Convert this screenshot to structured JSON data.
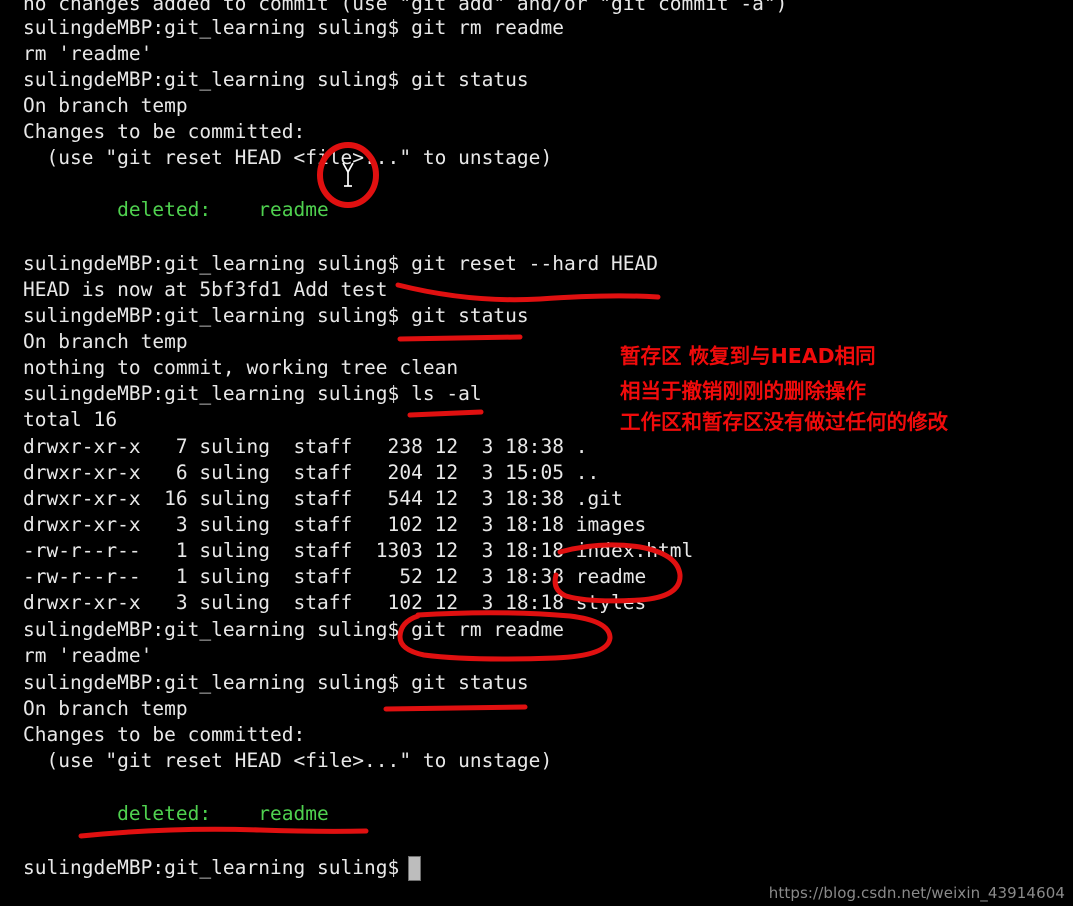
{
  "terminal": {
    "background_color": "#000000",
    "text_color": "#e8e8e8",
    "green_color": "#4fd14f",
    "annotation_color": "#f00b0b",
    "prompt": "sulingdeMBP:git_learning suling$",
    "lines": [
      {
        "text": "no changes added to commit (use \"git add\" and/or \"git commit -a\")",
        "color": "white"
      },
      {
        "text": "sulingdeMBP:git_learning suling$ git rm readme",
        "color": "white"
      },
      {
        "text": "rm 'readme'",
        "color": "white"
      },
      {
        "text": "sulingdeMBP:git_learning suling$ git status",
        "color": "white"
      },
      {
        "text": "On branch temp",
        "color": "white"
      },
      {
        "text": "Changes to be committed:",
        "color": "white"
      },
      {
        "text": "  (use \"git reset HEAD <file>...\" to unstage)",
        "color": "white"
      },
      {
        "text": "",
        "color": "white"
      },
      {
        "text": "        deleted:    readme",
        "color": "green"
      },
      {
        "text": "",
        "color": "white"
      },
      {
        "text": "sulingdeMBP:git_learning suling$ git reset --hard HEAD",
        "color": "white"
      },
      {
        "text": "HEAD is now at 5bf3fd1 Add test",
        "color": "white"
      },
      {
        "text": "sulingdeMBP:git_learning suling$ git status",
        "color": "white"
      },
      {
        "text": "On branch temp",
        "color": "white"
      },
      {
        "text": "nothing to commit, working tree clean",
        "color": "white"
      },
      {
        "text": "sulingdeMBP:git_learning suling$ ls -al",
        "color": "white"
      },
      {
        "text": "total 16",
        "color": "white"
      },
      {
        "text": "drwxr-xr-x   7 suling  staff   238 12  3 18:38 .",
        "color": "white"
      },
      {
        "text": "drwxr-xr-x   6 suling  staff   204 12  3 15:05 ..",
        "color": "white"
      },
      {
        "text": "drwxr-xr-x  16 suling  staff   544 12  3 18:38 .git",
        "color": "white"
      },
      {
        "text": "drwxr-xr-x   3 suling  staff   102 12  3 18:18 images",
        "color": "white"
      },
      {
        "text": "-rw-r--r--   1 suling  staff  1303 12  3 18:18 index.html",
        "color": "white"
      },
      {
        "text": "-rw-r--r--   1 suling  staff    52 12  3 18:38 readme",
        "color": "white"
      },
      {
        "text": "drwxr-xr-x   3 suling  staff   102 12  3 18:18 styles",
        "color": "white"
      },
      {
        "text": "sulingdeMBP:git_learning suling$ git rm readme",
        "color": "white"
      },
      {
        "text": "rm 'readme'",
        "color": "white"
      },
      {
        "text": "sulingdeMBP:git_learning suling$ git status",
        "color": "white"
      },
      {
        "text": "On branch temp",
        "color": "white"
      },
      {
        "text": "Changes to be committed:",
        "color": "white"
      },
      {
        "text": "  (use \"git reset HEAD <file>...\" to unstage)",
        "color": "white"
      },
      {
        "text": "",
        "color": "white"
      },
      {
        "text": "        deleted:    readme",
        "color": "green"
      },
      {
        "text": "",
        "color": "white"
      },
      {
        "text": "sulingdeMBP:git_learning suling$ ",
        "color": "white"
      }
    ]
  },
  "annotations": {
    "notes": [
      {
        "text": "暂存区 恢复到与HEAD相同"
      },
      {
        "text": "相当于撤销刚刚的删除操作"
      },
      {
        "text": "工作区和暂存区没有做过任何的修改"
      }
    ],
    "marks": [
      {
        "kind": "circle",
        "target": "text-cursor-in-unstage-hint"
      },
      {
        "kind": "underline",
        "target": "git-reset-hard-head-command"
      },
      {
        "kind": "underline",
        "target": "git-status-command-after-reset"
      },
      {
        "kind": "underline",
        "target": "ls-al-command"
      },
      {
        "kind": "ellipse",
        "target": "readme-file-listing"
      },
      {
        "kind": "ellipse",
        "target": "git-rm-readme-command"
      },
      {
        "kind": "underline",
        "target": "git-status-command-after-rm"
      },
      {
        "kind": "underline",
        "target": "deleted-readme-status"
      }
    ]
  },
  "watermark": {
    "text": "https://blog.csdn.net/weixin_43914604"
  }
}
